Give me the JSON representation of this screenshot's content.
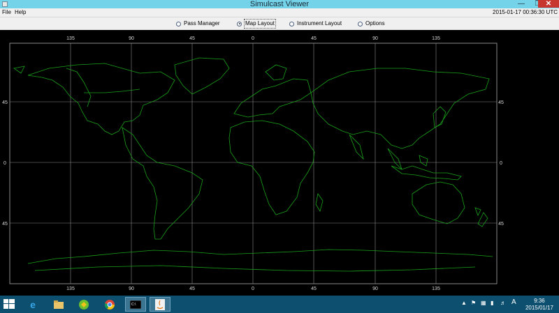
{
  "window": {
    "title": "Simulcast Viewer"
  },
  "menu": {
    "file": "File",
    "help": "Help",
    "clock": "2015-01-17 00:36:30 UTC"
  },
  "tabs": [
    {
      "label": "Pass Manager",
      "selected": false
    },
    {
      "label": "Map Layout",
      "selected": true
    },
    {
      "label": "Instrument Layout",
      "selected": false
    },
    {
      "label": "Options",
      "selected": false
    }
  ],
  "map": {
    "longitude_labels": [
      "135",
      "90",
      "45",
      "0",
      "45",
      "90",
      "135"
    ],
    "latitude_labels": [
      "45",
      "0",
      "45"
    ],
    "coastline_color": "#1aa31a",
    "grid_color": "#8a8a8a"
  },
  "taskbar": {
    "apps": [
      "internet-explorer",
      "file-explorer",
      "app-sync",
      "chrome",
      "command-prompt",
      "java"
    ],
    "tray_ime": "A",
    "time": "9:36",
    "date": "2015/01/17"
  }
}
